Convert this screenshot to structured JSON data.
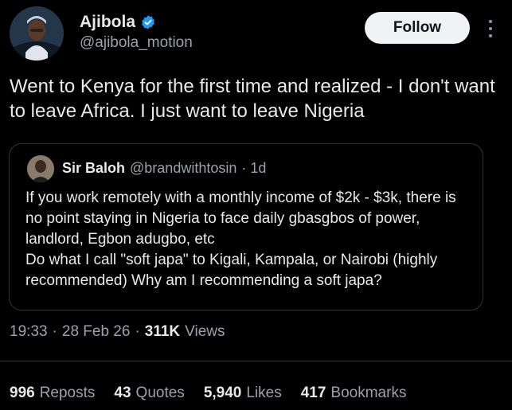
{
  "author": {
    "name": "Ajibola",
    "handle": "@ajibola_motion",
    "verified_color": "#1d9bf0"
  },
  "follow_label": "Follow",
  "tweet_text": "Went to Kenya for the first time and realized  -  I don't want to leave Africa. I just want to leave Nigeria",
  "quote": {
    "name": "Sir Baloh",
    "handle": "@brandwithtosin",
    "age": "· 1d",
    "text": "If you work remotely with a monthly income of $2k - $3k, there is no point staying in Nigeria to face daily gbasgbos of power, landlord, Egbon adugbo, etc\nDo what I call \"soft japa\" to Kigali, Kampala, or Nairobi (highly recommended) Why am I recommending a soft japa?"
  },
  "meta": {
    "time": "19:33",
    "sep1": "·",
    "date": "28 Feb 26",
    "sep2": "·",
    "views_count": "311K",
    "views_label": "Views"
  },
  "stats": {
    "reposts_count": "996",
    "reposts_label": "Reposts",
    "quotes_count": "43",
    "quotes_label": "Quotes",
    "likes_count": "5,940",
    "likes_label": "Likes",
    "bookmarks_count": "417",
    "bookmarks_label": "Bookmarks"
  },
  "colors": {
    "background": "#000000",
    "text_primary": "#e7e9ea",
    "text_secondary": "#9aa3ab",
    "border": "#2f3336",
    "accent": "#1d9bf0"
  }
}
